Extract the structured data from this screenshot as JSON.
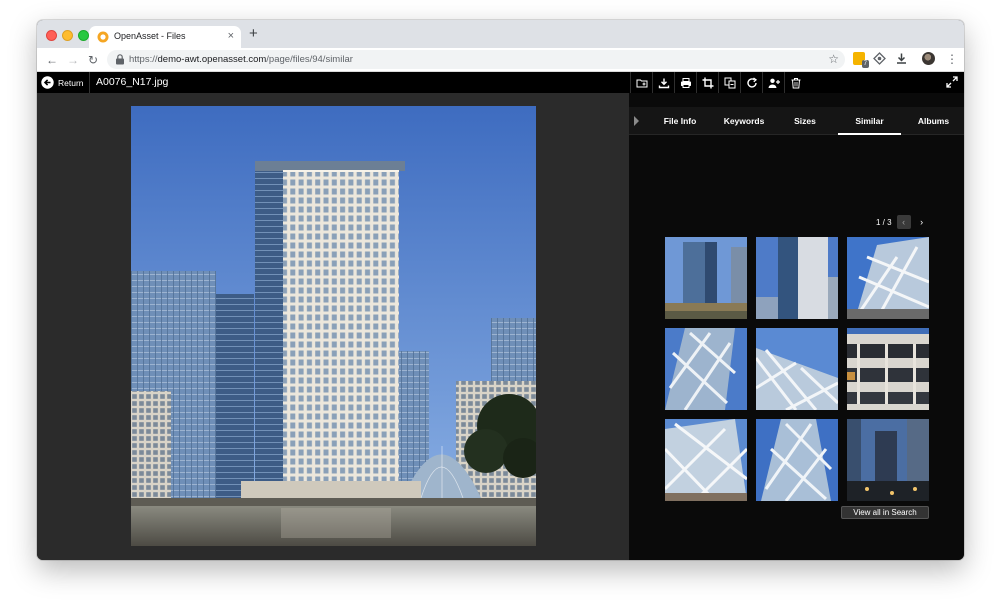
{
  "browser": {
    "tab_title": "OpenAsset - Files",
    "tab_close": "×",
    "new_tab": "+",
    "url_scheme": "https://",
    "url_host": "demo-awt.openasset.com",
    "url_path": "/page/files/94/similar",
    "extension_badge": "7",
    "nav_back": "←",
    "nav_forward": "→",
    "nav_reload": "↻",
    "star": "☆",
    "menu": "⋮"
  },
  "app": {
    "return_label": "Return",
    "filename": "A0076_N17.jpg",
    "toolbar_icons": [
      "folder-add-icon",
      "download-icon",
      "print-icon",
      "crop-icon",
      "convert-icon",
      "rotate-icon",
      "add-user-icon",
      "trash-icon"
    ]
  },
  "panel": {
    "tabs": [
      {
        "label": "File Info",
        "active": false
      },
      {
        "label": "Keywords",
        "active": false
      },
      {
        "label": "Sizes",
        "active": false
      },
      {
        "label": "Similar",
        "active": true
      },
      {
        "label": "Albums",
        "active": false
      }
    ],
    "pagination": "1 / 3",
    "prev": "‹",
    "next": "›",
    "view_all_label": "View all in Search"
  },
  "colors": {
    "sky": "#3f6fc2",
    "panel_bg": "#0a0a0a",
    "stage_bg": "#2b2b2b"
  }
}
